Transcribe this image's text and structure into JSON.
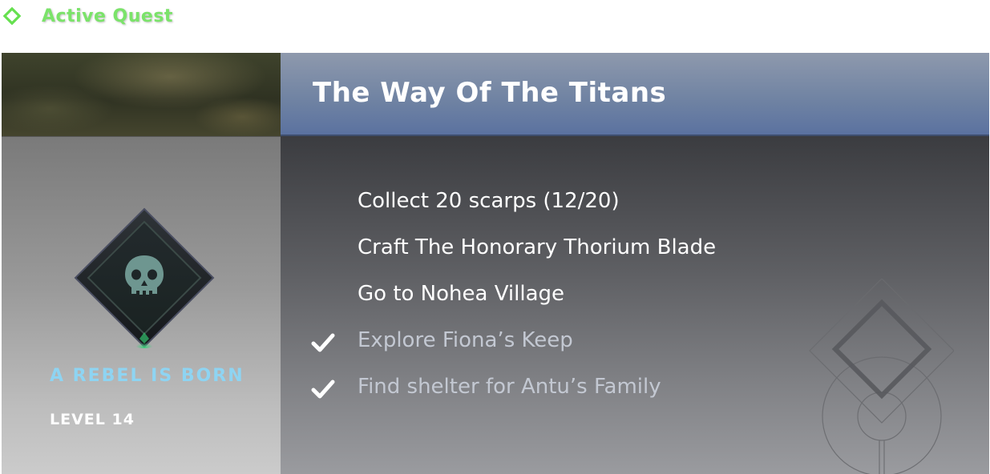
{
  "header": {
    "label": "Active Quest",
    "icon": "diamond-outline-icon",
    "accent_color": "#7be36a"
  },
  "quest": {
    "title": "The Way Of The Titans",
    "name": "A REBEL IS BORN",
    "level": "LEVEL 14",
    "badge_icon": "skull-icon",
    "name_color": "#8ed4f2",
    "objectives": [
      {
        "text": "Collect 20 scarps  (12/20)",
        "completed": false
      },
      {
        "text": "Craft The Honorary Thorium Blade",
        "completed": false
      },
      {
        "text": "Go to Nohea Village",
        "completed": false
      },
      {
        "text": "Explore Fiona’s Keep",
        "completed": true
      },
      {
        "text": "Find shelter for Antu’s Family",
        "completed": true
      }
    ]
  }
}
